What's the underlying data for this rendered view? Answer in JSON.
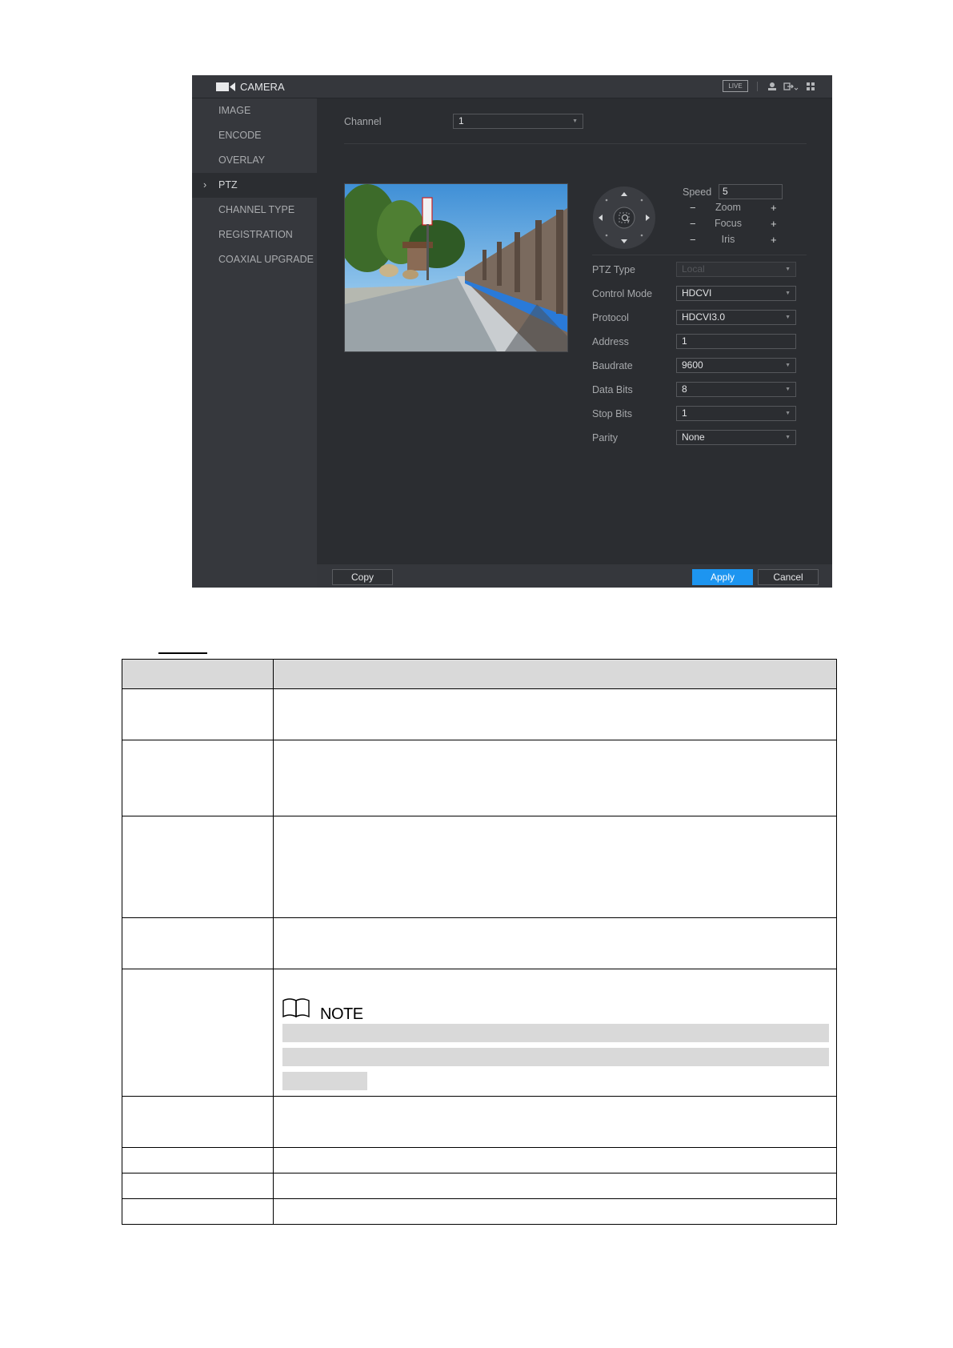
{
  "window": {
    "title": "CAMERA",
    "live_badge": "LIVE"
  },
  "sidebar": {
    "items": [
      {
        "label": "IMAGE"
      },
      {
        "label": "ENCODE"
      },
      {
        "label": "OVERLAY"
      },
      {
        "label": "PTZ",
        "active": true,
        "marker": "›"
      },
      {
        "label": "CHANNEL TYPE"
      },
      {
        "label": "REGISTRATION"
      },
      {
        "label": "COAXIAL UPGRADE"
      }
    ]
  },
  "channel": {
    "label": "Channel",
    "value": "1"
  },
  "ptz_controls": {
    "speed_label": "Speed",
    "speed_value": "5",
    "zoom_label": "Zoom",
    "focus_label": "Focus",
    "iris_label": "Iris",
    "minus": "−",
    "plus": "+"
  },
  "settings": {
    "ptz_type": {
      "label": "PTZ Type",
      "value": "Local"
    },
    "control_mode": {
      "label": "Control Mode",
      "value": "HDCVI"
    },
    "protocol": {
      "label": "Protocol",
      "value": "HDCVI3.0"
    },
    "address": {
      "label": "Address",
      "value": "1"
    },
    "baudrate": {
      "label": "Baudrate",
      "value": "9600"
    },
    "data_bits": {
      "label": "Data Bits",
      "value": "8"
    },
    "stop_bits": {
      "label": "Stop Bits",
      "value": "1"
    },
    "parity": {
      "label": "Parity",
      "value": "None"
    }
  },
  "footer": {
    "copy": "Copy",
    "apply": "Apply",
    "cancel": "Cancel"
  },
  "doc_table": {
    "note_title": "NOTE"
  },
  "colors": {
    "accent": "#1d95f0",
    "window_bg": "#2f3136",
    "table_header": "#d9d9d9"
  },
  "icons": [
    "camera-icon",
    "user-icon",
    "logout-icon",
    "grid-icon",
    "book-icon",
    "ptz-direction-pad-icon"
  ]
}
